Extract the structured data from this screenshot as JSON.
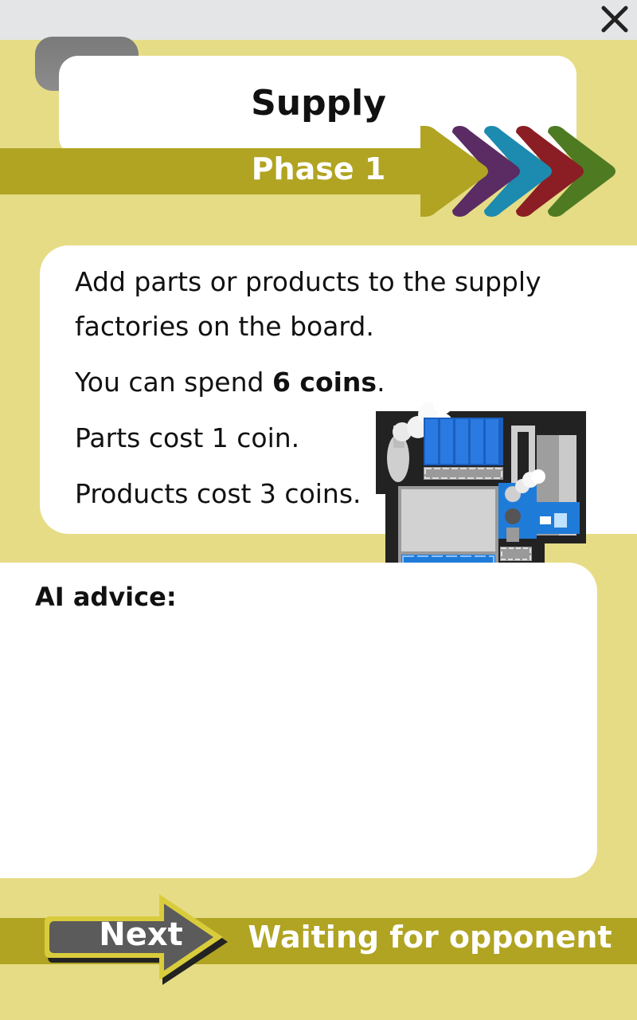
{
  "header": {
    "title": "Supply",
    "phase_label": "Phase 1",
    "phase_chevron_colors": [
      "#b0a422",
      "#5a2c63",
      "#1d8ab0",
      "#8a1e24",
      "#4e7a22"
    ]
  },
  "info": {
    "line1": "Add parts or products to the supply factories on the board.",
    "spend_prefix": "You can spend ",
    "spend_amount": "6 coins",
    "spend_suffix": ".",
    "parts_cost": "Parts cost 1 coin.",
    "products_cost": "Products cost 3 coins."
  },
  "advice": {
    "label": "AI advice:",
    "text": ""
  },
  "footer": {
    "next_label": "Next",
    "status": "Waiting for opponent"
  },
  "colors": {
    "background": "#e6dc86",
    "band": "#b0a422",
    "accent_blue": "#1f6fd6"
  }
}
